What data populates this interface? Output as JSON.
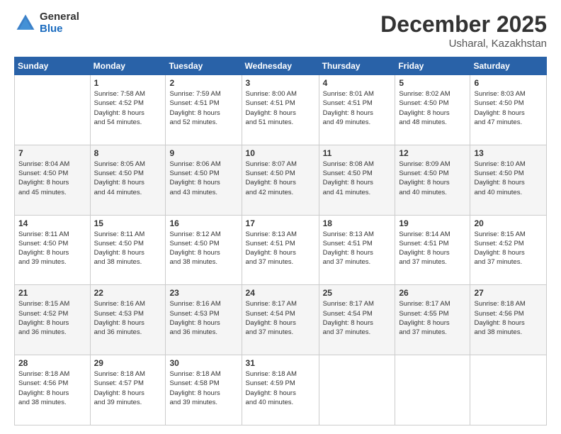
{
  "header": {
    "logo_general": "General",
    "logo_blue": "Blue",
    "month_title": "December 2025",
    "location": "Usharal, Kazakhstan"
  },
  "weekdays": [
    "Sunday",
    "Monday",
    "Tuesday",
    "Wednesday",
    "Thursday",
    "Friday",
    "Saturday"
  ],
  "weeks": [
    [
      {
        "day": "",
        "info": ""
      },
      {
        "day": "1",
        "info": "Sunrise: 7:58 AM\nSunset: 4:52 PM\nDaylight: 8 hours\nand 54 minutes."
      },
      {
        "day": "2",
        "info": "Sunrise: 7:59 AM\nSunset: 4:51 PM\nDaylight: 8 hours\nand 52 minutes."
      },
      {
        "day": "3",
        "info": "Sunrise: 8:00 AM\nSunset: 4:51 PM\nDaylight: 8 hours\nand 51 minutes."
      },
      {
        "day": "4",
        "info": "Sunrise: 8:01 AM\nSunset: 4:51 PM\nDaylight: 8 hours\nand 49 minutes."
      },
      {
        "day": "5",
        "info": "Sunrise: 8:02 AM\nSunset: 4:50 PM\nDaylight: 8 hours\nand 48 minutes."
      },
      {
        "day": "6",
        "info": "Sunrise: 8:03 AM\nSunset: 4:50 PM\nDaylight: 8 hours\nand 47 minutes."
      }
    ],
    [
      {
        "day": "7",
        "info": "Sunrise: 8:04 AM\nSunset: 4:50 PM\nDaylight: 8 hours\nand 45 minutes."
      },
      {
        "day": "8",
        "info": "Sunrise: 8:05 AM\nSunset: 4:50 PM\nDaylight: 8 hours\nand 44 minutes."
      },
      {
        "day": "9",
        "info": "Sunrise: 8:06 AM\nSunset: 4:50 PM\nDaylight: 8 hours\nand 43 minutes."
      },
      {
        "day": "10",
        "info": "Sunrise: 8:07 AM\nSunset: 4:50 PM\nDaylight: 8 hours\nand 42 minutes."
      },
      {
        "day": "11",
        "info": "Sunrise: 8:08 AM\nSunset: 4:50 PM\nDaylight: 8 hours\nand 41 minutes."
      },
      {
        "day": "12",
        "info": "Sunrise: 8:09 AM\nSunset: 4:50 PM\nDaylight: 8 hours\nand 40 minutes."
      },
      {
        "day": "13",
        "info": "Sunrise: 8:10 AM\nSunset: 4:50 PM\nDaylight: 8 hours\nand 40 minutes."
      }
    ],
    [
      {
        "day": "14",
        "info": "Sunrise: 8:11 AM\nSunset: 4:50 PM\nDaylight: 8 hours\nand 39 minutes."
      },
      {
        "day": "15",
        "info": "Sunrise: 8:11 AM\nSunset: 4:50 PM\nDaylight: 8 hours\nand 38 minutes."
      },
      {
        "day": "16",
        "info": "Sunrise: 8:12 AM\nSunset: 4:50 PM\nDaylight: 8 hours\nand 38 minutes."
      },
      {
        "day": "17",
        "info": "Sunrise: 8:13 AM\nSunset: 4:51 PM\nDaylight: 8 hours\nand 37 minutes."
      },
      {
        "day": "18",
        "info": "Sunrise: 8:13 AM\nSunset: 4:51 PM\nDaylight: 8 hours\nand 37 minutes."
      },
      {
        "day": "19",
        "info": "Sunrise: 8:14 AM\nSunset: 4:51 PM\nDaylight: 8 hours\nand 37 minutes."
      },
      {
        "day": "20",
        "info": "Sunrise: 8:15 AM\nSunset: 4:52 PM\nDaylight: 8 hours\nand 37 minutes."
      }
    ],
    [
      {
        "day": "21",
        "info": "Sunrise: 8:15 AM\nSunset: 4:52 PM\nDaylight: 8 hours\nand 36 minutes."
      },
      {
        "day": "22",
        "info": "Sunrise: 8:16 AM\nSunset: 4:53 PM\nDaylight: 8 hours\nand 36 minutes."
      },
      {
        "day": "23",
        "info": "Sunrise: 8:16 AM\nSunset: 4:53 PM\nDaylight: 8 hours\nand 36 minutes."
      },
      {
        "day": "24",
        "info": "Sunrise: 8:17 AM\nSunset: 4:54 PM\nDaylight: 8 hours\nand 37 minutes."
      },
      {
        "day": "25",
        "info": "Sunrise: 8:17 AM\nSunset: 4:54 PM\nDaylight: 8 hours\nand 37 minutes."
      },
      {
        "day": "26",
        "info": "Sunrise: 8:17 AM\nSunset: 4:55 PM\nDaylight: 8 hours\nand 37 minutes."
      },
      {
        "day": "27",
        "info": "Sunrise: 8:18 AM\nSunset: 4:56 PM\nDaylight: 8 hours\nand 38 minutes."
      }
    ],
    [
      {
        "day": "28",
        "info": "Sunrise: 8:18 AM\nSunset: 4:56 PM\nDaylight: 8 hours\nand 38 minutes."
      },
      {
        "day": "29",
        "info": "Sunrise: 8:18 AM\nSunset: 4:57 PM\nDaylight: 8 hours\nand 39 minutes."
      },
      {
        "day": "30",
        "info": "Sunrise: 8:18 AM\nSunset: 4:58 PM\nDaylight: 8 hours\nand 39 minutes."
      },
      {
        "day": "31",
        "info": "Sunrise: 8:18 AM\nSunset: 4:59 PM\nDaylight: 8 hours\nand 40 minutes."
      },
      {
        "day": "",
        "info": ""
      },
      {
        "day": "",
        "info": ""
      },
      {
        "day": "",
        "info": ""
      }
    ]
  ]
}
